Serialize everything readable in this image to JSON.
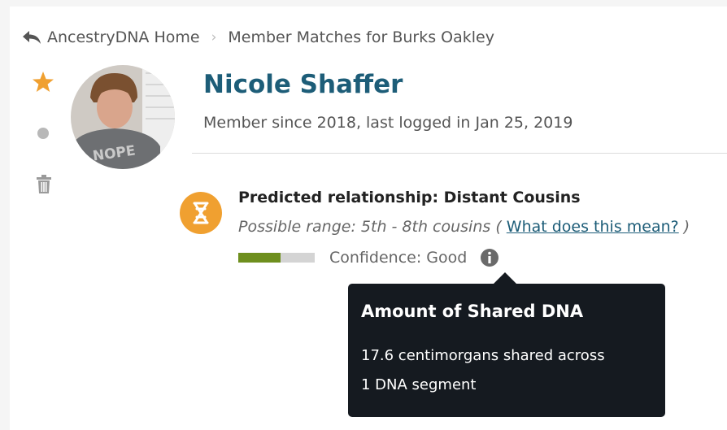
{
  "breadcrumb": {
    "home_label": "AncestryDNA Home",
    "current_label": "Member Matches for Burks Oakley",
    "separator": "›"
  },
  "actions": {
    "star_icon": "star-icon",
    "star_color": "#f0a030",
    "dot_icon": "circle-icon",
    "trash_icon": "trash-icon"
  },
  "member": {
    "name": "Nicole Shaffer",
    "meta": "Member since 2018, last logged in Jan 25, 2019",
    "avatar_shirt_text": "NOPE",
    "name_color": "#1d5d78"
  },
  "relationship": {
    "icon": "dna-icon",
    "icon_color": "#f0a030",
    "title": "Predicted relationship: Distant Cousins",
    "range_prefix": "Possible range: 5th - 8th cousins (",
    "help_link": "What does this mean?",
    "range_suffix": ")",
    "confidence_label": "Confidence: Good",
    "confidence_level": 0.55,
    "confidence_color": "#6e8f1e"
  },
  "tooltip": {
    "title": "Amount of Shared DNA",
    "line1": "17.6 centimorgans shared across",
    "line2": "1 DNA segment"
  }
}
